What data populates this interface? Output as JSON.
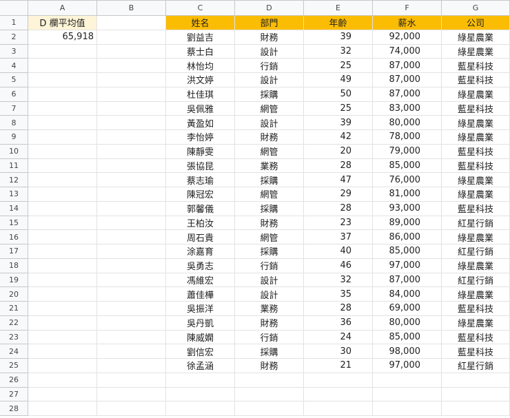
{
  "column_letters": [
    "A",
    "B",
    "C",
    "D",
    "E",
    "F",
    "G"
  ],
  "summary": {
    "label": "D 欄平均值",
    "value": "65,918"
  },
  "headers": {
    "name": "姓名",
    "dept": "部門",
    "age": "年齡",
    "salary": "薪水",
    "company": "公司"
  },
  "rows": [
    [
      "劉益吉",
      "財務",
      "39",
      "92,000",
      "綠星農業"
    ],
    [
      "蔡士白",
      "設計",
      "32",
      "74,000",
      "綠星農業"
    ],
    [
      "林怡均",
      "行銷",
      "25",
      "87,000",
      "藍星科技"
    ],
    [
      "洪文婷",
      "設計",
      "49",
      "87,000",
      "藍星科技"
    ],
    [
      "杜佳琪",
      "採購",
      "50",
      "87,000",
      "綠星農業"
    ],
    [
      "吳佩雅",
      "網管",
      "25",
      "83,000",
      "藍星科技"
    ],
    [
      "黃盈如",
      "設計",
      "39",
      "80,000",
      "綠星農業"
    ],
    [
      "李怡婷",
      "財務",
      "42",
      "78,000",
      "綠星農業"
    ],
    [
      "陳靜雯",
      "網管",
      "20",
      "79,000",
      "藍星科技"
    ],
    [
      "張協昆",
      "業務",
      "28",
      "85,000",
      "藍星科技"
    ],
    [
      "蔡志瑜",
      "採購",
      "47",
      "76,000",
      "綠星農業"
    ],
    [
      "陳冠宏",
      "網管",
      "29",
      "81,000",
      "綠星農業"
    ],
    [
      "郭馨儀",
      "採購",
      "28",
      "93,000",
      "藍星科技"
    ],
    [
      "王柏汝",
      "財務",
      "23",
      "89,000",
      "紅星行銷"
    ],
    [
      "周石貴",
      "網管",
      "37",
      "86,000",
      "綠星農業"
    ],
    [
      "涂嘉育",
      "採購",
      "40",
      "85,000",
      "紅星行銷"
    ],
    [
      "吳勇志",
      "行銷",
      "46",
      "97,000",
      "綠星農業"
    ],
    [
      "馮維宏",
      "設計",
      "32",
      "87,000",
      "紅星行銷"
    ],
    [
      "蕭佳樺",
      "設計",
      "35",
      "84,000",
      "綠星農業"
    ],
    [
      "吳振洋",
      "業務",
      "28",
      "69,000",
      "藍星科技"
    ],
    [
      "吳丹凱",
      "財務",
      "36",
      "80,000",
      "綠星農業"
    ],
    [
      "陳威嫻",
      "行銷",
      "24",
      "85,000",
      "藍星科技"
    ],
    [
      "劉信宏",
      "採購",
      "30",
      "98,000",
      "藍星科技"
    ],
    [
      "徐孟涵",
      "財務",
      "21",
      "97,000",
      "紅星行銷"
    ]
  ],
  "row_count": 28
}
